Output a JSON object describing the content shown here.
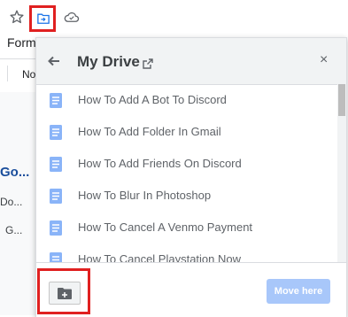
{
  "background": {
    "form_text": "Form",
    "no_text": "No",
    "go_text": "Go...",
    "do_text": "Do...",
    "g_text": "G..."
  },
  "icons": {
    "star": "star-icon",
    "move": "move-to-folder-icon",
    "cloud": "cloud-saved-icon"
  },
  "dialog": {
    "title": "My Drive",
    "back_icon": "back-arrow-icon",
    "external_icon": "open-external-icon",
    "close_label": "×",
    "files": [
      "How To Add A Bot To Discord",
      "How To Add Folder In Gmail",
      "How To Add Friends On Discord",
      "How To Blur In Photoshop",
      "How To Cancel A Venmo Payment",
      "How To Cancel Playstation Now"
    ],
    "new_folder_icon": "new-folder-icon",
    "move_here_label": "Move here"
  },
  "colors": {
    "highlight": "#e02020",
    "doc_icon": "#8ab4f8",
    "move_here_bg": "#a8c7fa",
    "link_blue": "#1a4e9c"
  }
}
